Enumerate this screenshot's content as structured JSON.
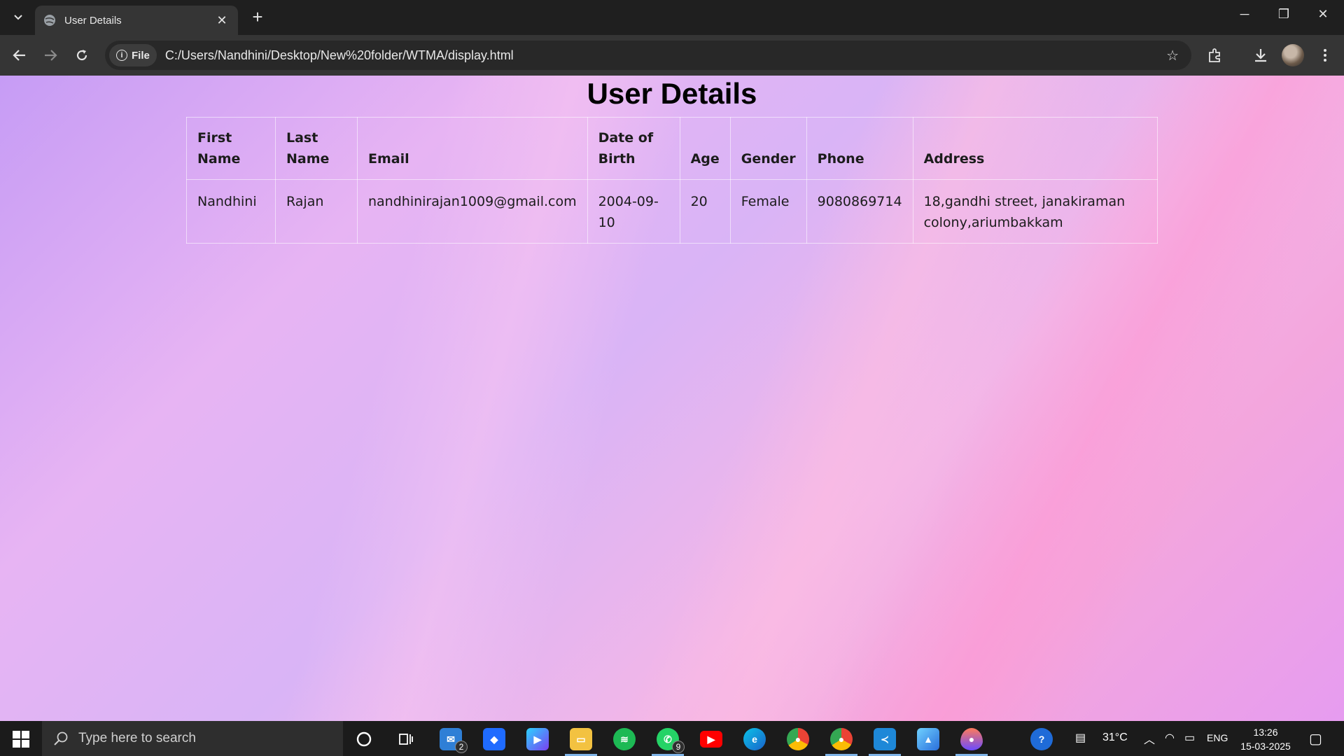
{
  "browser": {
    "tab_title": "User Details",
    "url_chip": "File",
    "url": "C:/Users/Nandhini/Desktop/New%20folder/WTMA/display.html"
  },
  "page": {
    "title": "User Details",
    "table": {
      "headers": [
        "First Name",
        "Last Name",
        "Email",
        "Date of Birth",
        "Age",
        "Gender",
        "Phone",
        "Address"
      ],
      "rows": [
        [
          "Nandhini",
          "Rajan",
          "nandhinirajan1009@gmail.com",
          "2004-09-10",
          "20",
          "Female",
          "9080869714",
          "18,gandhi street, janakiraman colony,ariumbakkam"
        ]
      ]
    }
  },
  "taskbar": {
    "search_placeholder": "Type here to search",
    "mail_badge": "2",
    "whatsapp_badge": "9",
    "temperature": "31°C",
    "language": "ENG",
    "time": "13:26",
    "date": "15-03-2025"
  }
}
